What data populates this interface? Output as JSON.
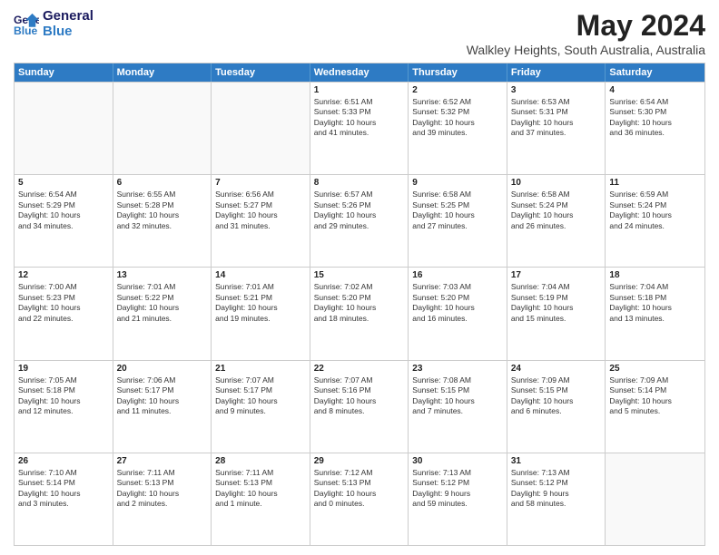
{
  "logo": {
    "line1": "General",
    "line2": "Blue"
  },
  "title": "May 2024",
  "subtitle": "Walkley Heights, South Australia, Australia",
  "days": [
    "Sunday",
    "Monday",
    "Tuesday",
    "Wednesday",
    "Thursday",
    "Friday",
    "Saturday"
  ],
  "weeks": [
    [
      {
        "day": "",
        "info": ""
      },
      {
        "day": "",
        "info": ""
      },
      {
        "day": "",
        "info": ""
      },
      {
        "day": "1",
        "info": "Sunrise: 6:51 AM\nSunset: 5:33 PM\nDaylight: 10 hours\nand 41 minutes."
      },
      {
        "day": "2",
        "info": "Sunrise: 6:52 AM\nSunset: 5:32 PM\nDaylight: 10 hours\nand 39 minutes."
      },
      {
        "day": "3",
        "info": "Sunrise: 6:53 AM\nSunset: 5:31 PM\nDaylight: 10 hours\nand 37 minutes."
      },
      {
        "day": "4",
        "info": "Sunrise: 6:54 AM\nSunset: 5:30 PM\nDaylight: 10 hours\nand 36 minutes."
      }
    ],
    [
      {
        "day": "5",
        "info": "Sunrise: 6:54 AM\nSunset: 5:29 PM\nDaylight: 10 hours\nand 34 minutes."
      },
      {
        "day": "6",
        "info": "Sunrise: 6:55 AM\nSunset: 5:28 PM\nDaylight: 10 hours\nand 32 minutes."
      },
      {
        "day": "7",
        "info": "Sunrise: 6:56 AM\nSunset: 5:27 PM\nDaylight: 10 hours\nand 31 minutes."
      },
      {
        "day": "8",
        "info": "Sunrise: 6:57 AM\nSunset: 5:26 PM\nDaylight: 10 hours\nand 29 minutes."
      },
      {
        "day": "9",
        "info": "Sunrise: 6:58 AM\nSunset: 5:25 PM\nDaylight: 10 hours\nand 27 minutes."
      },
      {
        "day": "10",
        "info": "Sunrise: 6:58 AM\nSunset: 5:24 PM\nDaylight: 10 hours\nand 26 minutes."
      },
      {
        "day": "11",
        "info": "Sunrise: 6:59 AM\nSunset: 5:24 PM\nDaylight: 10 hours\nand 24 minutes."
      }
    ],
    [
      {
        "day": "12",
        "info": "Sunrise: 7:00 AM\nSunset: 5:23 PM\nDaylight: 10 hours\nand 22 minutes."
      },
      {
        "day": "13",
        "info": "Sunrise: 7:01 AM\nSunset: 5:22 PM\nDaylight: 10 hours\nand 21 minutes."
      },
      {
        "day": "14",
        "info": "Sunrise: 7:01 AM\nSunset: 5:21 PM\nDaylight: 10 hours\nand 19 minutes."
      },
      {
        "day": "15",
        "info": "Sunrise: 7:02 AM\nSunset: 5:20 PM\nDaylight: 10 hours\nand 18 minutes."
      },
      {
        "day": "16",
        "info": "Sunrise: 7:03 AM\nSunset: 5:20 PM\nDaylight: 10 hours\nand 16 minutes."
      },
      {
        "day": "17",
        "info": "Sunrise: 7:04 AM\nSunset: 5:19 PM\nDaylight: 10 hours\nand 15 minutes."
      },
      {
        "day": "18",
        "info": "Sunrise: 7:04 AM\nSunset: 5:18 PM\nDaylight: 10 hours\nand 13 minutes."
      }
    ],
    [
      {
        "day": "19",
        "info": "Sunrise: 7:05 AM\nSunset: 5:18 PM\nDaylight: 10 hours\nand 12 minutes."
      },
      {
        "day": "20",
        "info": "Sunrise: 7:06 AM\nSunset: 5:17 PM\nDaylight: 10 hours\nand 11 minutes."
      },
      {
        "day": "21",
        "info": "Sunrise: 7:07 AM\nSunset: 5:17 PM\nDaylight: 10 hours\nand 9 minutes."
      },
      {
        "day": "22",
        "info": "Sunrise: 7:07 AM\nSunset: 5:16 PM\nDaylight: 10 hours\nand 8 minutes."
      },
      {
        "day": "23",
        "info": "Sunrise: 7:08 AM\nSunset: 5:15 PM\nDaylight: 10 hours\nand 7 minutes."
      },
      {
        "day": "24",
        "info": "Sunrise: 7:09 AM\nSunset: 5:15 PM\nDaylight: 10 hours\nand 6 minutes."
      },
      {
        "day": "25",
        "info": "Sunrise: 7:09 AM\nSunset: 5:14 PM\nDaylight: 10 hours\nand 5 minutes."
      }
    ],
    [
      {
        "day": "26",
        "info": "Sunrise: 7:10 AM\nSunset: 5:14 PM\nDaylight: 10 hours\nand 3 minutes."
      },
      {
        "day": "27",
        "info": "Sunrise: 7:11 AM\nSunset: 5:13 PM\nDaylight: 10 hours\nand 2 minutes."
      },
      {
        "day": "28",
        "info": "Sunrise: 7:11 AM\nSunset: 5:13 PM\nDaylight: 10 hours\nand 1 minute."
      },
      {
        "day": "29",
        "info": "Sunrise: 7:12 AM\nSunset: 5:13 PM\nDaylight: 10 hours\nand 0 minutes."
      },
      {
        "day": "30",
        "info": "Sunrise: 7:13 AM\nSunset: 5:12 PM\nDaylight: 9 hours\nand 59 minutes."
      },
      {
        "day": "31",
        "info": "Sunrise: 7:13 AM\nSunset: 5:12 PM\nDaylight: 9 hours\nand 58 minutes."
      },
      {
        "day": "",
        "info": ""
      }
    ]
  ]
}
